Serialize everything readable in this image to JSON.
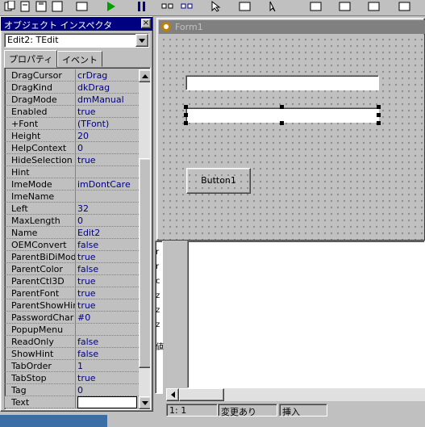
{
  "inspector": {
    "title": "オブジェクト インスペクタ",
    "close_glyph": "×",
    "object_selector": "Edit2: TEdit",
    "tabs": [
      "プロパティ",
      "イベント"
    ],
    "properties": [
      {
        "name": "DragCursor",
        "value": "crDrag"
      },
      {
        "name": "DragKind",
        "value": "dkDrag"
      },
      {
        "name": "DragMode",
        "value": "dmManual"
      },
      {
        "name": "Enabled",
        "value": "true"
      },
      {
        "name": "+Font",
        "value": "(TFont)"
      },
      {
        "name": "Height",
        "value": "20"
      },
      {
        "name": "HelpContext",
        "value": "0"
      },
      {
        "name": "HideSelection",
        "value": "true"
      },
      {
        "name": "Hint",
        "value": ""
      },
      {
        "name": "ImeMode",
        "value": "imDontCare"
      },
      {
        "name": "ImeName",
        "value": ""
      },
      {
        "name": "Left",
        "value": "32"
      },
      {
        "name": "MaxLength",
        "value": "0"
      },
      {
        "name": "Name",
        "value": "Edit2"
      },
      {
        "name": "OEMConvert",
        "value": "false"
      },
      {
        "name": "ParentBiDiMode",
        "value": "true"
      },
      {
        "name": "ParentColor",
        "value": "false"
      },
      {
        "name": "ParentCtl3D",
        "value": "true"
      },
      {
        "name": "ParentFont",
        "value": "true"
      },
      {
        "name": "ParentShowHint",
        "value": "true"
      },
      {
        "name": "PasswordChar",
        "value": "#0"
      },
      {
        "name": "PopupMenu",
        "value": ""
      },
      {
        "name": "ReadOnly",
        "value": "false"
      },
      {
        "name": "ShowHint",
        "value": "false"
      },
      {
        "name": "TabOrder",
        "value": "1"
      },
      {
        "name": "TabStop",
        "value": "true"
      },
      {
        "name": "Tag",
        "value": "0"
      },
      {
        "name": "Text",
        "value": ""
      }
    ]
  },
  "form": {
    "title": "Form1",
    "button_label": "Button1"
  },
  "editor": {
    "gutter_marks": [
      "r",
      "r",
      "c",
      "z",
      "z",
      "z"
    ],
    "side_label": "値",
    "status": {
      "position": "1:   1",
      "modified": "変更あり",
      "mode": "挿入"
    }
  },
  "colors": {
    "title_active": "#000080",
    "title_inactive": "#808080",
    "face": "#c0c0c0",
    "value_text": "#000080"
  }
}
